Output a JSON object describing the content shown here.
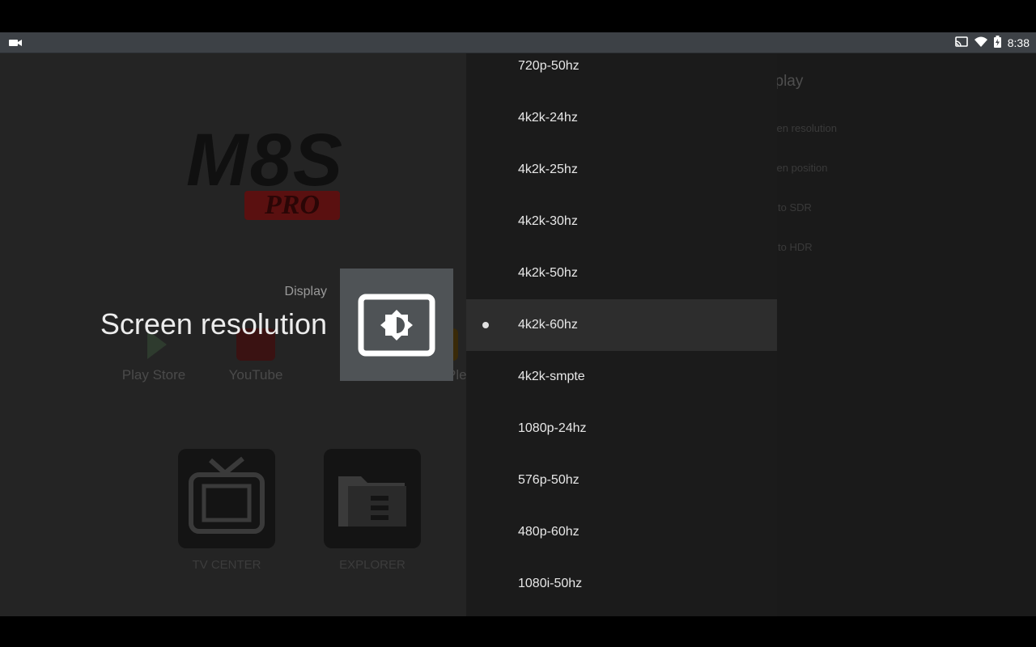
{
  "status_bar": {
    "left_icon": "video-camera-icon",
    "icons": [
      "cast-icon",
      "wifi-icon",
      "battery-charging-icon"
    ],
    "time": "8:38"
  },
  "launcher": {
    "logo_text": "M8S",
    "logo_badge": "PRO",
    "apps": [
      {
        "label": "Play Store",
        "icon": "play-store-icon"
      },
      {
        "label": "YouTube",
        "icon": "youtube-icon"
      },
      {
        "label": "Ple",
        "icon": "plex-icon"
      }
    ],
    "tiles": [
      {
        "label": "TV CENTER",
        "icon": "tv-icon"
      },
      {
        "label": "EXPLORER",
        "icon": "folder-icon"
      }
    ]
  },
  "detail": {
    "breadcrumb": "Display",
    "heading": "Screen resolution",
    "icon": "brightness-display-icon"
  },
  "options": {
    "items": [
      {
        "label": "720p-50hz",
        "selected": false
      },
      {
        "label": "4k2k-24hz",
        "selected": false
      },
      {
        "label": "4k2k-25hz",
        "selected": false
      },
      {
        "label": "4k2k-30hz",
        "selected": false
      },
      {
        "label": "4k2k-50hz",
        "selected": false
      },
      {
        "label": "4k2k-60hz",
        "selected": true
      },
      {
        "label": "4k2k-smpte",
        "selected": false
      },
      {
        "label": "1080p-24hz",
        "selected": false
      },
      {
        "label": "576p-50hz",
        "selected": false
      },
      {
        "label": "480p-60hz",
        "selected": false
      },
      {
        "label": "1080i-50hz",
        "selected": false
      }
    ]
  },
  "settings_list": {
    "title": "splay",
    "items": [
      "reen resolution",
      "reen position",
      "R to SDR",
      "R to HDR"
    ]
  },
  "colors": {
    "panel": "#1b1b1b",
    "selected_row": "#2d2d2d",
    "status_bar": "#3d4146"
  }
}
